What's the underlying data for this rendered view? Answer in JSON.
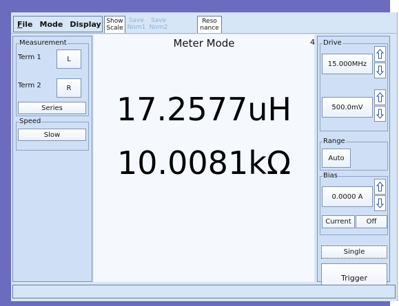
{
  "menu": {
    "file": "File",
    "mode": "Mode",
    "display": "Display"
  },
  "toolbar": {
    "show_scale": [
      "Show",
      "Scale"
    ],
    "save_nom1": [
      "Save",
      "Nom1"
    ],
    "save_nom2": [
      "Save",
      "Nom2"
    ],
    "resonance": [
      "Reso",
      "nance"
    ]
  },
  "measurement": {
    "legend": "Measurement",
    "term1_label": "Term 1",
    "term1_value": "L",
    "term2_label": "Term 2",
    "term2_value": "R",
    "circuit": "Series"
  },
  "speed": {
    "legend": "Speed",
    "value": "Slow"
  },
  "display": {
    "title": "Meter Mode",
    "primary": "17.2577uH",
    "secondary": "10.0081kΩ",
    "page": "4"
  },
  "drive": {
    "legend": "Drive",
    "frequency": "15.000MHz",
    "level": "500.0mV"
  },
  "range": {
    "legend": "Range",
    "value": "Auto"
  },
  "bias": {
    "legend": "Bias",
    "value": "0.0000 A",
    "type": "Current",
    "state": "Off"
  },
  "trigger": {
    "mode": "Single",
    "button": "Trigger"
  },
  "colors": {
    "panel": "#cfe0f6",
    "frame": "#6b6bbf",
    "display_bg": "#f5f9fe"
  }
}
